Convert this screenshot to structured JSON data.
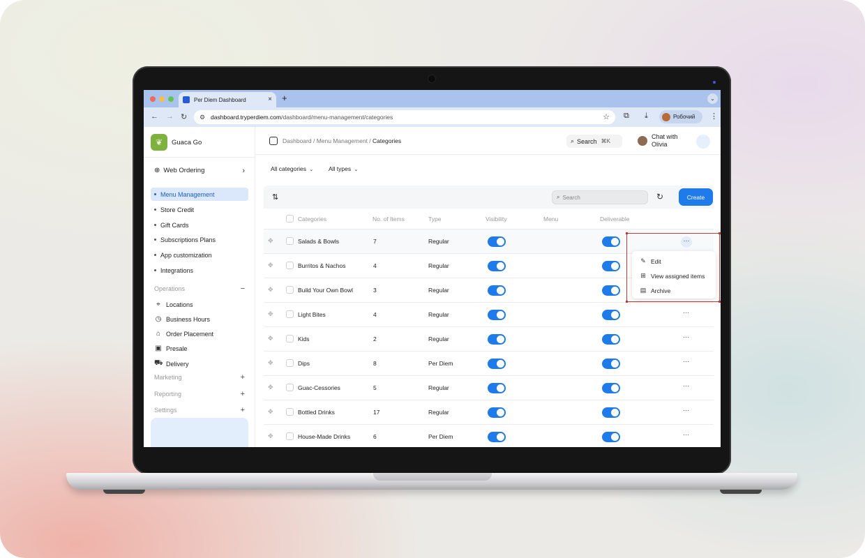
{
  "browser": {
    "tab_title": "Per Diem Dashboard",
    "url_host": "dashboard.tryperdiem.com",
    "url_path": "/dashboard/menu-management/categories",
    "profile": "Робочий",
    "new_tab": "+",
    "tab_close": "×",
    "collapse": "⌄"
  },
  "sidebar": {
    "brand": "Guaca Go",
    "web_ordering": "Web Ordering",
    "sub_items": [
      {
        "label": "Menu Management",
        "active": true
      },
      {
        "label": "Store Credit"
      },
      {
        "label": "Gift Cards"
      },
      {
        "label": "Subscriptions Plans"
      },
      {
        "label": "App customization"
      },
      {
        "label": "Integrations"
      }
    ],
    "operations": {
      "label": "Operations",
      "sign": "−"
    },
    "operations_items": [
      {
        "label": "Locations",
        "icon": "map-pin-icon"
      },
      {
        "label": "Business Hours",
        "icon": "clock-icon"
      },
      {
        "label": "Order Placement",
        "icon": "store-icon"
      },
      {
        "label": "Presale",
        "icon": "bag-icon"
      },
      {
        "label": "Delivery",
        "icon": "truck-icon"
      }
    ],
    "marketing": {
      "label": "Marketing",
      "sign": "+"
    },
    "reporting": {
      "label": "Reporting",
      "sign": "+"
    },
    "settings": {
      "label": "Settings",
      "sign": "+"
    }
  },
  "header": {
    "breadcrumb_1": "Dashboard",
    "breadcrumb_sep": " / ",
    "breadcrumb_2": "Menu Management",
    "breadcrumb_3": "Categories",
    "search_label": "Search",
    "search_kbd": "⌘K",
    "chat_line1": "Chat with",
    "chat_line2": "Olivia"
  },
  "filters": {
    "categories": "All categories",
    "types": "All types"
  },
  "toolbar": {
    "search_placeholder": "Search",
    "create_label": "Create"
  },
  "table": {
    "columns": [
      "Categories",
      "No. of Items",
      "Type",
      "Visibility",
      "Menu",
      "Deliverable"
    ],
    "rows": [
      {
        "name": "Salads & Bowls",
        "items": "7",
        "type": "Regular",
        "visible": true,
        "deliverable": true
      },
      {
        "name": "Burritos & Nachos",
        "items": "4",
        "type": "Regular",
        "visible": true,
        "deliverable": true
      },
      {
        "name": "Build Your Own Bowl",
        "items": "3",
        "type": "Regular",
        "visible": true,
        "deliverable": true
      },
      {
        "name": "Light Bites",
        "items": "4",
        "type": "Regular",
        "visible": true,
        "deliverable": true
      },
      {
        "name": "Kids",
        "items": "2",
        "type": "Regular",
        "visible": true,
        "deliverable": true
      },
      {
        "name": "Dips",
        "items": "8",
        "type": "Per Diem",
        "visible": true,
        "deliverable": true
      },
      {
        "name": "Guac-Cessories",
        "items": "5",
        "type": "Regular",
        "visible": true,
        "deliverable": true
      },
      {
        "name": "Bottled Drinks",
        "items": "17",
        "type": "Regular",
        "visible": true,
        "deliverable": true
      },
      {
        "name": "House-Made Drinks",
        "items": "6",
        "type": "Per Diem",
        "visible": true,
        "deliverable": true
      }
    ],
    "more_glyph": "···"
  },
  "context_menu": {
    "items": [
      {
        "label": "Edit",
        "icon": "pencil-icon"
      },
      {
        "label": "View assigned items",
        "icon": "grid-icon"
      },
      {
        "label": "Archive",
        "icon": "archive-icon"
      }
    ]
  },
  "colors": {
    "accent": "#1f7aea",
    "brand": "#7fb13f",
    "highlight": "#c03a3a"
  }
}
